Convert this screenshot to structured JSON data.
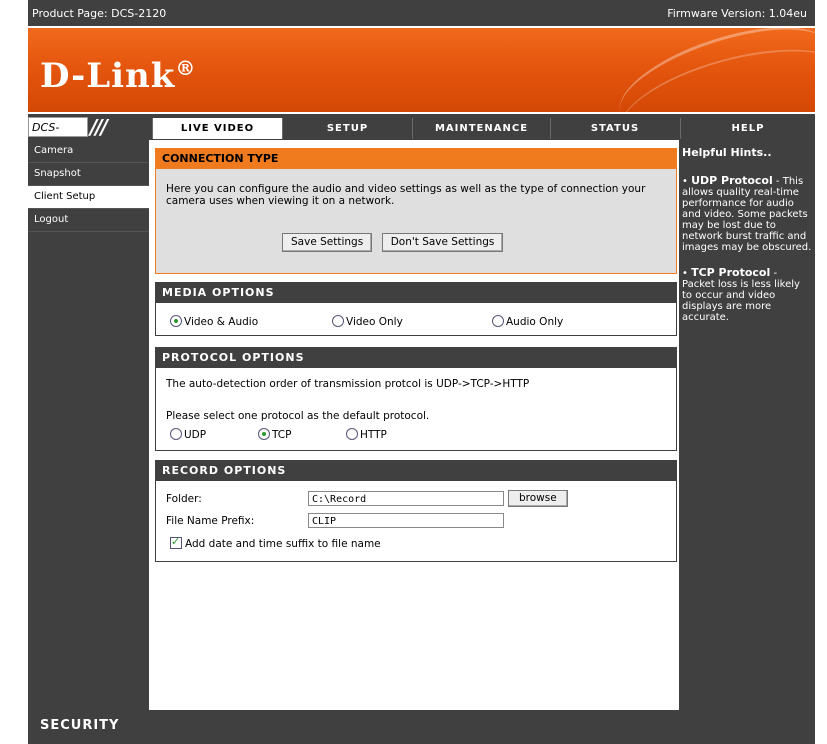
{
  "topbar": {
    "product": "Product Page: DCS-2120",
    "firmware": "Firmware Version: 1.04eu"
  },
  "brand": {
    "logo": "D-Link"
  },
  "nav": {
    "model": "DCS-2120",
    "tabs": [
      "LIVE VIDEO",
      "SETUP",
      "MAINTENANCE",
      "STATUS",
      "HELP"
    ],
    "active_tab": "LIVE VIDEO"
  },
  "sidebar": {
    "items": [
      "Camera",
      "Snapshot",
      "Client Setup",
      "Logout"
    ],
    "active": "Client Setup"
  },
  "connection": {
    "title": "CONNECTION TYPE",
    "description": "Here you can configure the audio and video settings as well as the type of connection your camera uses when viewing it on a network.",
    "save_label": "Save Settings",
    "dont_save_label": "Don't Save Settings"
  },
  "media": {
    "title": "MEDIA OPTIONS",
    "options": [
      "Video & Audio",
      "Video Only",
      "Audio Only"
    ],
    "selected": "Video & Audio"
  },
  "protocol": {
    "title": "PROTOCOL OPTIONS",
    "order_text": "The auto-detection order of transmission protcol is UDP->TCP->HTTP",
    "select_text": "Please select one protocol as the default protocol.",
    "options": [
      "UDP",
      "TCP",
      "HTTP"
    ],
    "selected": "TCP"
  },
  "record": {
    "title": "RECORD OPTIONS",
    "folder_label": "Folder:",
    "folder_value": "C:\\Record",
    "browse_label": "browse",
    "prefix_label": "File Name Prefix:",
    "prefix_value": "CLIP",
    "suffix_label": "Add date and time suffix to file name",
    "suffix_checked": true
  },
  "help": {
    "title": "Helpful Hints..",
    "udp_title": "UDP Protocol",
    "udp_text": "This allows quality real-time performance for audio and video. Some packets may be lost due to network burst traffic and images may be obscured.",
    "tcp_title": "TCP Protocol",
    "tcp_text": "Packet loss is less likely to occur and video displays are more accurate."
  },
  "footer": {
    "label": "SECURITY"
  },
  "colors": {
    "orange": "#f07a1e",
    "dark": "#404040",
    "panel": "#dfdfdf"
  }
}
